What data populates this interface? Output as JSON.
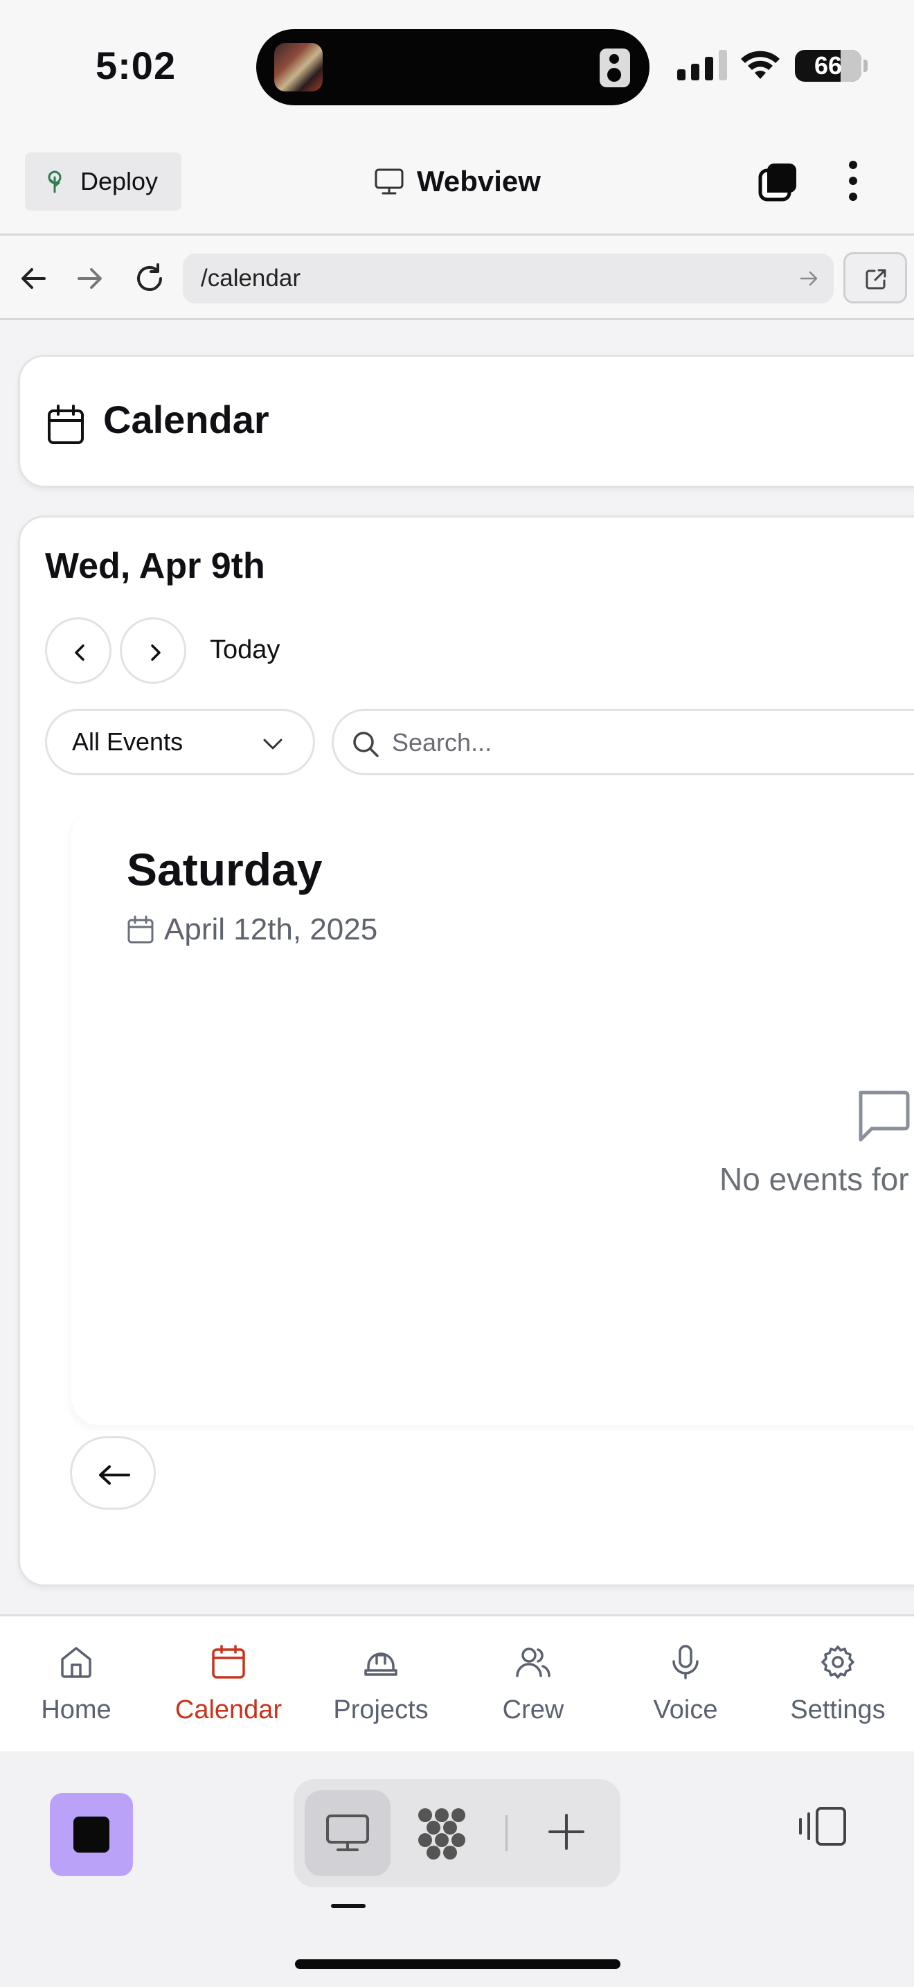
{
  "status_bar": {
    "time": "5:02",
    "battery": "66"
  },
  "toolbar": {
    "deploy_label": "Deploy",
    "title": "Webview"
  },
  "url_bar": {
    "url": "/calendar"
  },
  "header": {
    "title": "Calendar"
  },
  "calendar": {
    "current_date": "Wed, Apr 9th",
    "today_label": "Today",
    "filter_value": "All Events",
    "search_placeholder": "Search...",
    "day": {
      "name": "Saturday",
      "date": "April 12th, 2025",
      "empty_message": "No events for"
    }
  },
  "bottom_nav": {
    "items": [
      {
        "label": "Home",
        "icon": "home-icon"
      },
      {
        "label": "Calendar",
        "icon": "calendar-icon",
        "active": true
      },
      {
        "label": "Projects",
        "icon": "hard-hat-icon"
      },
      {
        "label": "Crew",
        "icon": "users-icon"
      },
      {
        "label": "Voice",
        "icon": "microphone-icon"
      },
      {
        "label": "Settings",
        "icon": "gear-icon"
      }
    ]
  },
  "colors": {
    "accent": "#c8331c",
    "app_tile": "#b9a2f7"
  }
}
